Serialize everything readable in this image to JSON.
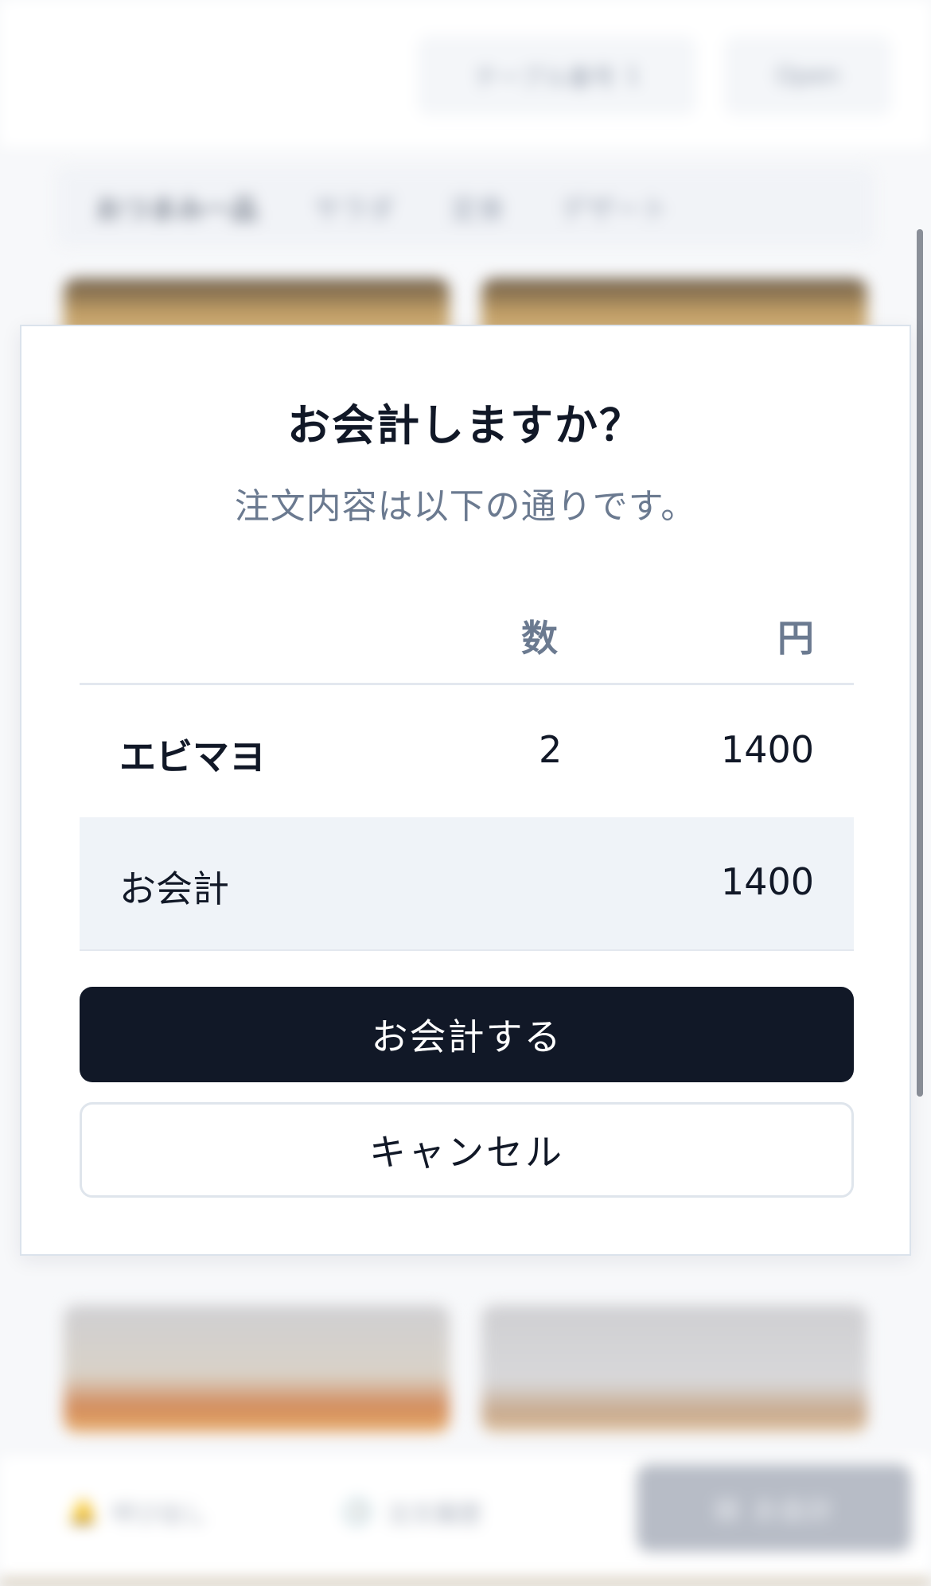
{
  "background": {
    "header": {
      "table_label": "テーブル番号",
      "table_value": "1",
      "menu_label": "Open"
    },
    "tabs": [
      "おつまみ一品",
      "サラダ",
      "定食",
      "デザート"
    ],
    "bottom_bar": {
      "call_label": "呼び出し",
      "history_label": "注文履歴",
      "checkout_label": "お会計"
    }
  },
  "modal": {
    "title": "お会計しますか？",
    "subtitle": "注文内容は以下の通りです。",
    "table": {
      "header_qty": "数",
      "header_price": "円",
      "items": [
        {
          "name": "エビマヨ",
          "qty": "2",
          "price": "1400"
        }
      ],
      "total_label": "お会計",
      "total_price": "1400"
    },
    "confirm_label": "お会計する",
    "cancel_label": "キャンセル"
  }
}
